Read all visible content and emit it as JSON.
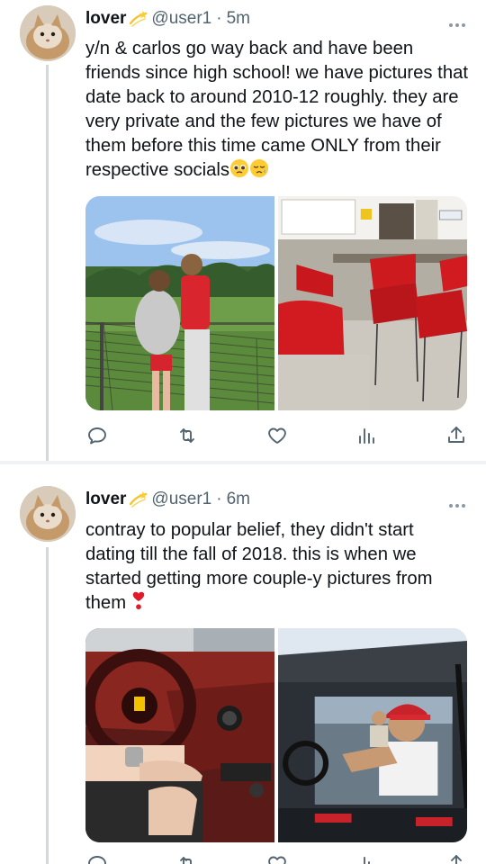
{
  "tweets": [
    {
      "display_name": "lover",
      "name_emoji": "dizzy-emoji",
      "handle": "@user1",
      "separator": "·",
      "time": "5m",
      "text": "y/n & carlos go way back and have been friends since high school! we have pictures that date back to around 2010-12 roughly. they are very private and the few pictures we have of them before this time came ONLY from their respective socials",
      "text_emojis": [
        "pleading-face-emoji",
        "disappointed-relieved-face-emoji"
      ],
      "photos": [
        "couple-hugging-at-sports-field-photo",
        "classroom-red-chairs-photo"
      ]
    },
    {
      "display_name": "lover",
      "name_emoji": "dizzy-emoji",
      "handle": "@user1",
      "separator": "·",
      "time": "6m",
      "text": "contray to popular belief, they didn't start dating till the fall of 2018. this is when we started getting more couple-y pictures from them",
      "text_emojis": [
        "heart-exclamation-emoji"
      ],
      "photos": [
        "red-car-interior-steering-wheel-photo",
        "man-in-car-cap-photo"
      ]
    }
  ],
  "action_icons": [
    "reply-icon",
    "retweet-icon",
    "like-icon",
    "views-icon",
    "share-icon"
  ],
  "colors": {
    "text": "#0f1419",
    "secondary": "#536471",
    "divider": "#eff3f4",
    "thread_line": "#cfd9de"
  }
}
